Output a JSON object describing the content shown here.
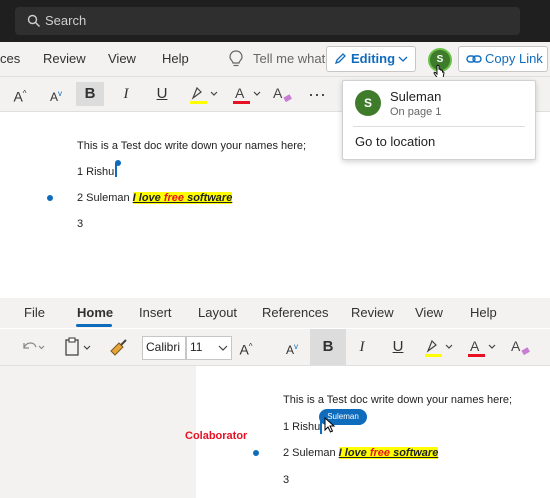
{
  "top": {
    "search": {
      "placeholder": "Search"
    },
    "menu": [
      "ces",
      "Review",
      "View",
      "Help"
    ],
    "tell_me": "Tell me what",
    "editing_label": "Editing",
    "avatar_initial": "S",
    "copy_link_label": "Copy Link",
    "popup": {
      "initial": "S",
      "name": "Suleman",
      "location": "On page 1",
      "go_to": "Go to location"
    },
    "doc": {
      "intro": "This is a Test doc write down your names here;",
      "line1": "1 Rishu",
      "line2_prefix": "2 Suleman ",
      "hl_a": "I love ",
      "hl_b": "free",
      "hl_c": " software",
      "line3": "3"
    }
  },
  "bottom": {
    "tabs": [
      "File",
      "Home",
      "Insert",
      "Layout",
      "References",
      "Review",
      "View",
      "Help"
    ],
    "font_name": "Calibri",
    "font_size": "11",
    "collab_tag": "Suleman",
    "collab_label": "Colaborator",
    "doc": {
      "intro": "This is a Test doc write down your names here;",
      "line1": "1 Rishu",
      "line2_prefix": "2 Suleman ",
      "hl_a": "I love ",
      "hl_b": "free",
      "hl_c": " software",
      "line3": "3"
    }
  },
  "colors": {
    "accent": "#0f6cbd",
    "highlight": "#ffff00",
    "red": "#e81123",
    "avatar": "#3e7c2b"
  }
}
